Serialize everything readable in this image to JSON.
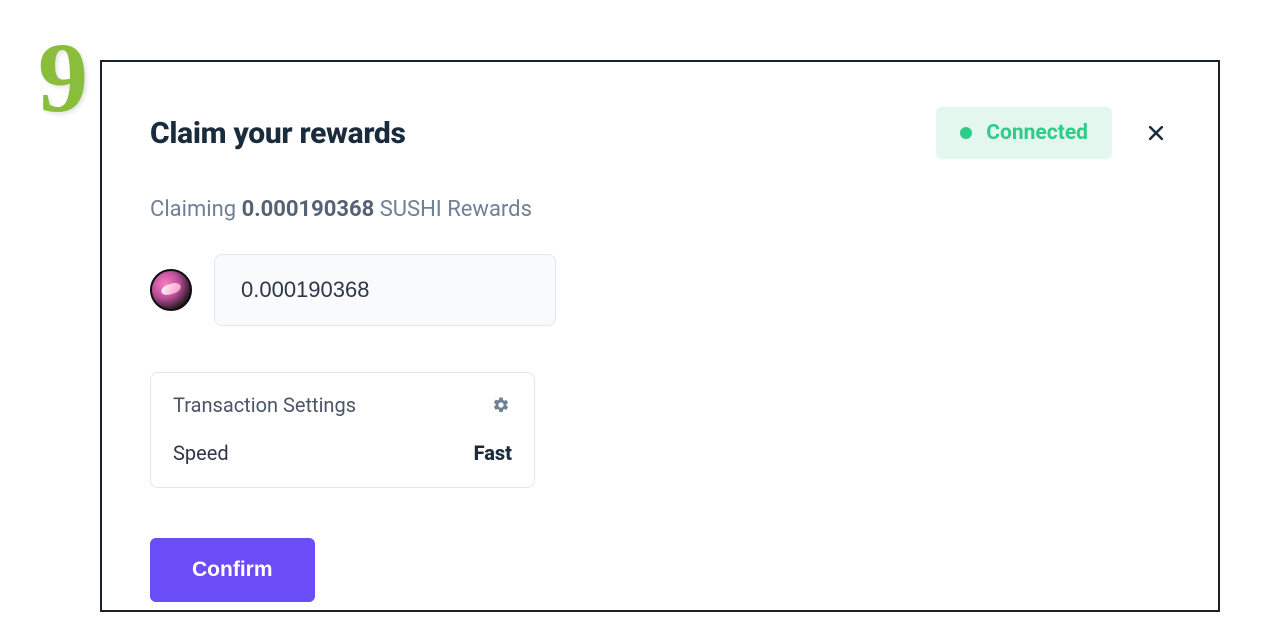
{
  "step": "9",
  "header": {
    "title": "Claim your rewards",
    "connection_label": "Connected"
  },
  "claiming": {
    "prefix": "Claiming",
    "amount": "0.000190368",
    "suffix": "SUSHI Rewards"
  },
  "amount_field": {
    "value": "0.000190368",
    "token": "sushi"
  },
  "tx_settings": {
    "title": "Transaction Settings",
    "speed_label": "Speed",
    "speed_value": "Fast"
  },
  "buttons": {
    "confirm": "Confirm"
  }
}
